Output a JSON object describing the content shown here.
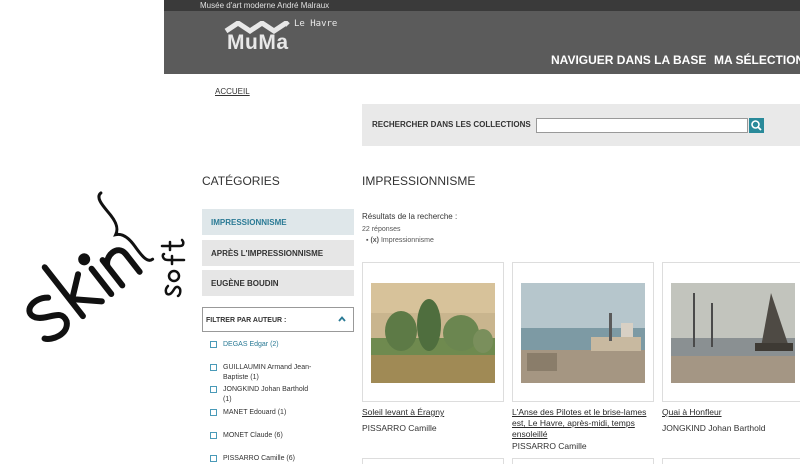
{
  "header": {
    "museum_name": "Musée d'art moderne André Malraux",
    "logo_text": "MuMa",
    "logo_subtext": "Le Havre",
    "nav": [
      "NAVIGUER DANS LA BASE",
      "MA SÉLECTION"
    ]
  },
  "overlay_logo": {
    "text": "skin soft"
  },
  "breadcrumb": "ACCUEIL",
  "search": {
    "label": "RECHERCHER DANS LES COLLECTIONS",
    "value": "",
    "placeholder": ""
  },
  "sidebar": {
    "title": "CATÉGORIES",
    "categories": [
      "IMPRESSIONNISME",
      "APRÈS L'IMPRESSIONNISME",
      "EUGÈNE BOUDIN"
    ],
    "filter_title": "FILTRER PAR AUTEUR :",
    "authors": [
      {
        "line1": "DEGAS Edgar (2)",
        "line2": ""
      },
      {
        "line1": "GUILLAUMIN Armand Jean-",
        "line2": "Baptiste (1)"
      },
      {
        "line1": "JONGKIND Johan Barthold",
        "line2": "(1)"
      },
      {
        "line1": "MANET Edouard (1)",
        "line2": ""
      },
      {
        "line1": "MONET Claude (6)",
        "line2": ""
      },
      {
        "line1": "PISSARRO Camille (6)",
        "line2": ""
      }
    ]
  },
  "results": {
    "title": "IMPRESSIONNISME",
    "heading": "Résultats de la recherche :",
    "count": "22 réponses",
    "filter_prefix": "(x)",
    "filter_label": "Impressionnisme",
    "items": [
      {
        "title_lines": [
          "Soleil levant à Éragny"
        ],
        "artist": "PISSARRO Camille"
      },
      {
        "title_lines": [
          "L'Anse des Pilotes et le brise-lames",
          "est, Le Havre, après-midi, temps",
          "ensoleillé"
        ],
        "artist": "PISSARRO Camille"
      },
      {
        "title_lines": [
          "Quai à Honfleur"
        ],
        "artist": "JONGKIND Johan Barthold"
      }
    ]
  },
  "colors": {
    "accent": "#2a7a95",
    "header_bg": "#5b5b5b",
    "topbar_bg": "#3a3a3a",
    "search_btn": "#2a8a9a"
  }
}
